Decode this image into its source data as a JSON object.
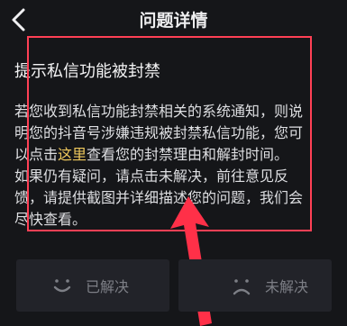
{
  "status": {
    "left_fragment": "",
    "center_fragment": "",
    "right_fragment": ""
  },
  "header": {
    "title": "问题详情",
    "back_icon": "chevron-left-icon"
  },
  "article": {
    "question": "提示私信功能被封禁",
    "answer_lines": [
      {
        "prefix": "若您收到私信功能封禁相关的系统通知，则说",
        "link": "",
        "suffix": ""
      },
      {
        "prefix": "明您的抖音号涉嫌违规被封禁私信功能，您可",
        "link": "",
        "suffix": ""
      },
      {
        "prefix": "以点击",
        "link": "这里",
        "suffix": "查看您的封禁理由和解封时间。"
      },
      {
        "prefix": "如果仍有疑问，请点击未解决，前往意见反",
        "link": "",
        "suffix": ""
      },
      {
        "prefix": "馈，请提供截图并详细描述您的问题，我们会",
        "link": "",
        "suffix": ""
      },
      {
        "prefix": "尽快查看。",
        "link": "",
        "suffix": ""
      }
    ]
  },
  "feedback": {
    "resolved_label": "已解决",
    "unresolved_label": "未解决",
    "resolved_icon": "smile-icon",
    "unresolved_icon": "sad-face-icon"
  },
  "colors": {
    "background": "#151619",
    "text": "#dedfe2",
    "link": "#f0c95d",
    "highlight": "#ff4055",
    "button_background": "#222329",
    "button_text": "#7d7f86"
  }
}
